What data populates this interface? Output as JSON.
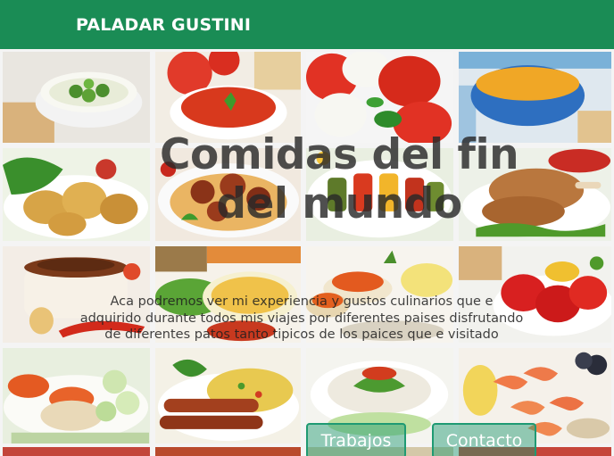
{
  "navbar": {
    "brand": "PALADAR GUSTINI",
    "bg_color": "#1a8c55"
  },
  "hero": {
    "title": "Comidas del fin del mundo",
    "description": "Aca podremos ver mi experiencia y gustos culinarios que e adquirido durante todos mis viajes por diferentes paises disfrutando de diferentes patos tanto tipicos de los paices que e visitado"
  },
  "buttons": {
    "trabajos": "Trabajos",
    "contacto": "Contacto",
    "accent_color": "#1f9a73"
  },
  "gallery": {
    "tiles": [
      "broccoli-soup",
      "tomato-soup",
      "caprese-salad",
      "pumpkin-soup",
      "fried-chicken-nuggets",
      "spaghetti-meatballs",
      "vegetable-skewers",
      "roast-chicken-legs",
      "meat-stew-pot",
      "bread-and-vegetables",
      "caviar-canapes",
      "stuffed-peppers",
      "caviar-cucumber-bites",
      "sausages-rice",
      "caviar-salad",
      "shrimp-platter",
      "strip-1",
      "strip-2",
      "strip-3",
      "strip-4"
    ]
  }
}
